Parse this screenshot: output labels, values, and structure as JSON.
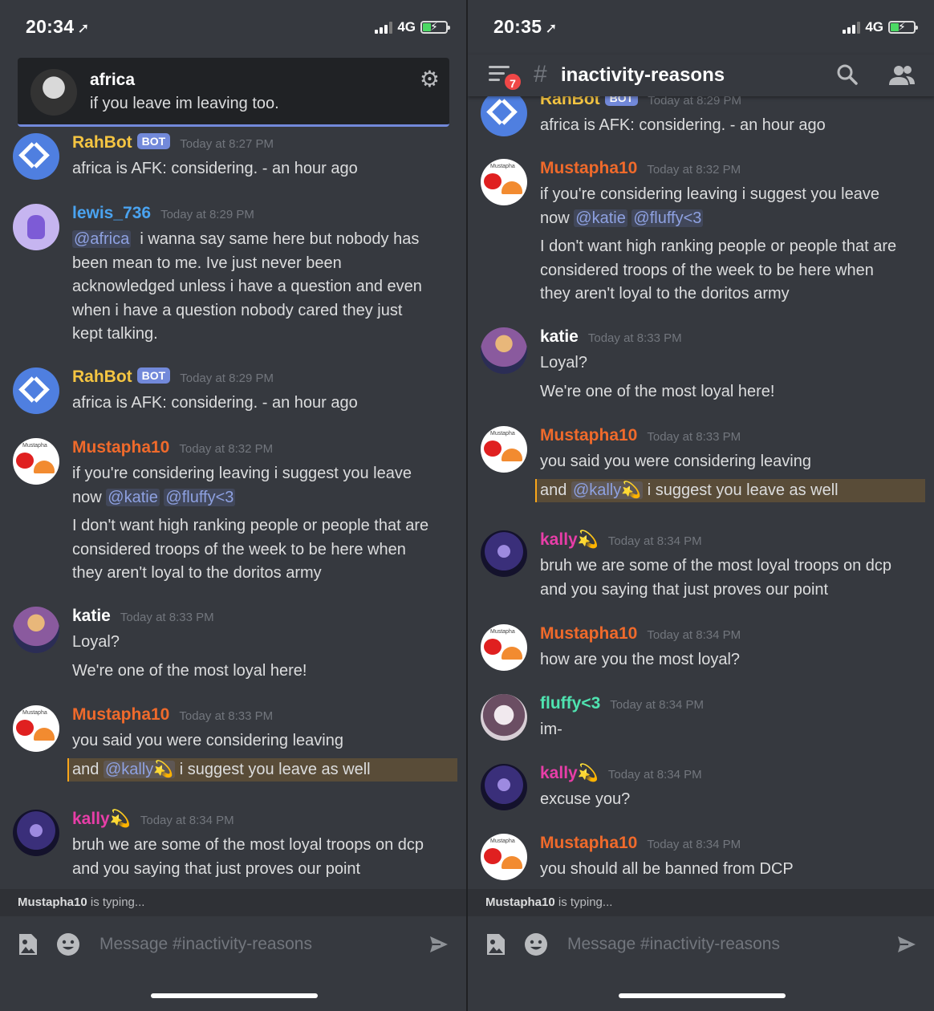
{
  "left": {
    "status": {
      "time": "20:34",
      "network": "4G"
    },
    "popup": {
      "name": "africa",
      "text": "if you leave im leaving too."
    },
    "messages": [
      {
        "user": "RahBot",
        "bot": "BOT",
        "time": "Today at 8:27 PM",
        "lines": [
          "africa is AFK: considering. - an hour ago"
        ]
      },
      {
        "user": "lewis_736",
        "time": "Today at 8:29 PM",
        "mention": "@africa",
        "lines": [
          "i wanna say same here but nobody has",
          "been mean to me. Ive just never been",
          "acknowledged unless i have a question and even",
          "when i have a question nobody cared they just",
          "kept talking."
        ]
      },
      {
        "user": "RahBot",
        "bot": "BOT",
        "time": "Today at 8:29 PM",
        "lines": [
          "africa is AFK: considering. - an hour ago"
        ]
      },
      {
        "user": "Mustapha10",
        "time": "Today at 8:32 PM",
        "line1": "if you're considering leaving i suggest you leave",
        "now": "now",
        "mentions": [
          "@katie",
          "@fluffy<3"
        ],
        "para": [
          "I don't want high ranking people or people that are",
          "considered troops of the week to be here when",
          "they aren't loyal to the doritos army"
        ]
      },
      {
        "user": "katie",
        "time": "Today at 8:33 PM",
        "lines": [
          "Loyal?",
          "We're one of the most loyal here!"
        ]
      },
      {
        "user": "Mustapha10",
        "time": "Today at 8:33 PM",
        "line1": "you said you were considering leaving",
        "hl_pre": "and",
        "hl_mention": "@kally💫",
        "hl_post": "i suggest you leave as well"
      },
      {
        "user": "kally💫",
        "time": "Today at 8:34 PM",
        "lines": [
          "bruh we are some of the most loyal troops on dcp",
          "and you saying that just proves our point"
        ]
      }
    ],
    "typing_user": "Mustapha10",
    "typing_suffix": "is typing...",
    "placeholder": "Message #inactivity-reasons"
  },
  "right": {
    "status": {
      "time": "20:35",
      "network": "4G"
    },
    "header": {
      "badge": "7",
      "hash": "#",
      "channel": "inactivity-reasons"
    },
    "messages": [
      {
        "user": "RahBot",
        "bot": "BOT",
        "time": "Today at 8:29 PM",
        "lines": [
          "africa is AFK: considering. - an hour ago"
        ]
      },
      {
        "user": "Mustapha10",
        "time": "Today at 8:32 PM",
        "line1": "if you're considering leaving i suggest you leave",
        "now": "now",
        "mentions": [
          "@katie",
          "@fluffy<3"
        ],
        "para": [
          "I don't want high ranking people or people that are",
          "considered troops of the week to be here when",
          "they aren't loyal to the doritos army"
        ]
      },
      {
        "user": "katie",
        "time": "Today at 8:33 PM",
        "lines": [
          "Loyal?",
          "We're one of the most loyal here!"
        ]
      },
      {
        "user": "Mustapha10",
        "time": "Today at 8:33 PM",
        "line1": "you said you were considering leaving",
        "hl_pre": "and",
        "hl_mention": "@kally💫",
        "hl_post": "i suggest you leave as well"
      },
      {
        "user": "kally💫",
        "time": "Today at 8:34 PM",
        "lines": [
          "bruh we are some of the most loyal troops on dcp",
          "and you saying that just proves our point"
        ]
      },
      {
        "user": "Mustapha10",
        "time": "Today at 8:34 PM",
        "lines": [
          "how are you the most loyal?"
        ]
      },
      {
        "user": "fluffy<3",
        "time": "Today at 8:34 PM",
        "lines": [
          "im-"
        ]
      },
      {
        "user": "kally💫",
        "time": "Today at 8:34 PM",
        "lines": [
          "excuse you?"
        ]
      },
      {
        "user": "Mustapha10",
        "time": "Today at 8:34 PM",
        "lines": [
          "you should all be banned from DCP"
        ]
      }
    ],
    "typing_user": "Mustapha10",
    "typing_suffix": "is typing...",
    "placeholder": "Message #inactivity-reasons"
  },
  "colors": {
    "rahbot": "#f5c542",
    "lewis": "#4aa3f0",
    "mustapha": "#f06a2b",
    "katie": "#ffffff",
    "kally": "#e83ea8",
    "fluffy": "#4fe3b0",
    "background": "#36393f",
    "mention": "#8ea1e1"
  },
  "icons": {
    "location": "location-arrow-icon",
    "gear": "gear-icon",
    "search": "search-icon",
    "members": "members-icon",
    "image": "image-upload-icon",
    "emoji": "emoji-icon",
    "send": "send-icon"
  }
}
